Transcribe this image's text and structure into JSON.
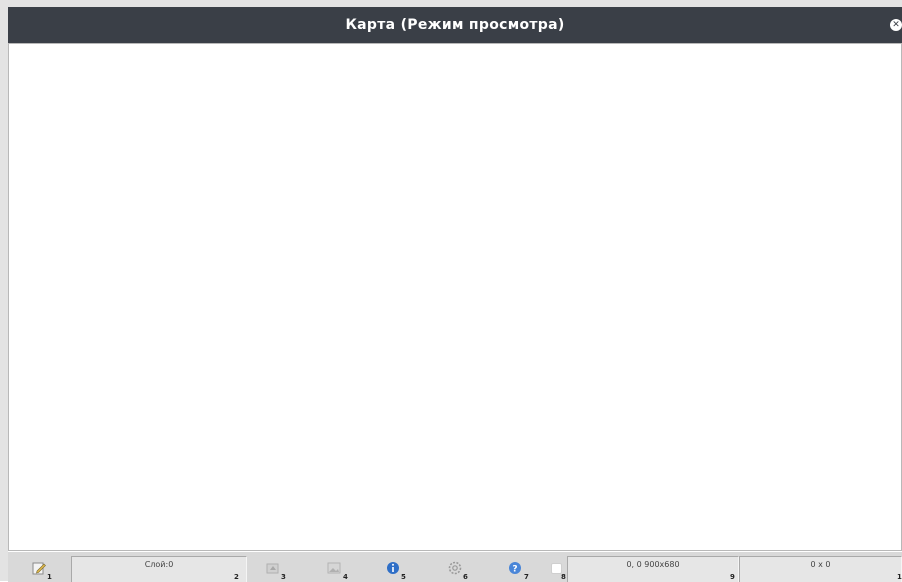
{
  "window": {
    "title": "Карта (Режим просмотра)",
    "close_icon": "close-icon"
  },
  "statusbar": {
    "items": [
      {
        "num": "1",
        "icon": "edit-icon"
      },
      {
        "num": "2",
        "text": "Слой:0"
      },
      {
        "num": "3",
        "icon": "layer-up-icon"
      },
      {
        "num": "4",
        "icon": "image-icon"
      },
      {
        "num": "5",
        "icon": "info-icon"
      },
      {
        "num": "6",
        "icon": "settings-icon"
      },
      {
        "num": "7",
        "icon": "help-icon"
      },
      {
        "num": "8",
        "checked": false
      },
      {
        "num": "9",
        "text": "0, 0 900x680"
      },
      {
        "num": "1",
        "text": "0 x 0"
      }
    ]
  },
  "colors": {
    "titlebar": "#3a3f47",
    "statusbar": "#d9d9d9",
    "info_blue": "#2f6fc7"
  }
}
